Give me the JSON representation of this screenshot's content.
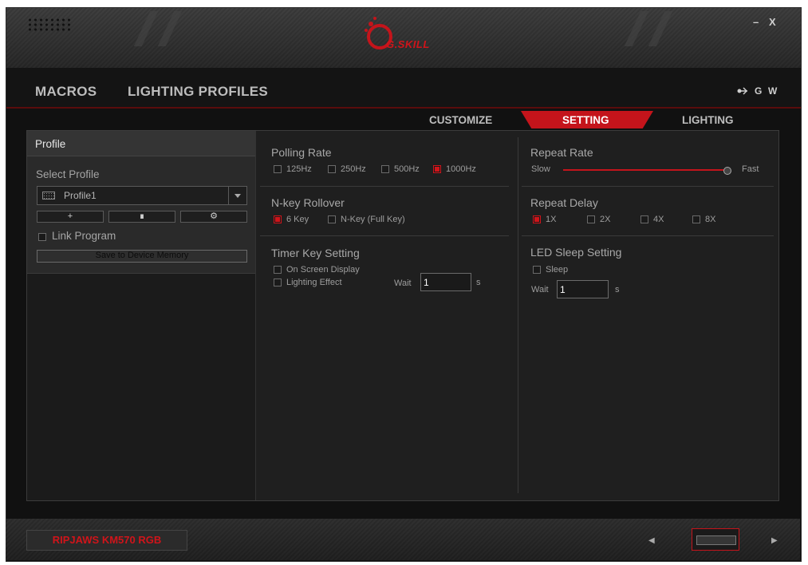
{
  "window": {
    "brand": "G.SKILL",
    "minimize": "–",
    "close": "X"
  },
  "nav": {
    "macros": "MACROS",
    "lighting_profiles": "LIGHTING PROFILES",
    "right_icons": [
      "link-icon",
      "G",
      "W"
    ],
    "g": "G",
    "w": "W"
  },
  "tabs": [
    {
      "label": "CUSTOMIZE",
      "active": false
    },
    {
      "label": "SETTING",
      "active": true
    },
    {
      "label": "LIGHTING",
      "active": false
    }
  ],
  "profile_panel": {
    "header": "Profile",
    "select_label": "Select Profile",
    "selected_profile": "Profile1",
    "add": "+",
    "delete": "∎",
    "settings": "⚙",
    "link_program": "Link Program",
    "save": "Save to Device Memory"
  },
  "polling": {
    "title": "Polling Rate",
    "options": [
      {
        "label": "125Hz",
        "checked": false
      },
      {
        "label": "250Hz",
        "checked": false
      },
      {
        "label": "500Hz",
        "checked": false
      },
      {
        "label": "1000Hz",
        "checked": true
      }
    ]
  },
  "rollover": {
    "title": "N-key Rollover",
    "options": [
      {
        "label": "6 Key",
        "checked": true
      },
      {
        "label": "N-Key (Full Key)",
        "checked": false
      }
    ]
  },
  "timer": {
    "title": "Timer Key Setting",
    "on_screen": "On Screen Display",
    "lighting_effect": "Lighting Effect",
    "wait_label": "Wait",
    "wait_value": "1",
    "unit": "s"
  },
  "repeat_rate": {
    "title": "Repeat Rate",
    "slow": "Slow",
    "fast": "Fast",
    "value": 1.0
  },
  "repeat_delay": {
    "title": "Repeat Delay",
    "options": [
      {
        "label": "1X",
        "checked": true
      },
      {
        "label": "2X",
        "checked": false
      },
      {
        "label": "4X",
        "checked": false
      },
      {
        "label": "8X",
        "checked": false
      }
    ]
  },
  "led_sleep": {
    "title": "LED Sleep Setting",
    "sleep": "Sleep",
    "wait_label": "Wait",
    "wait_value": "1",
    "unit": "s"
  },
  "footer": {
    "model": "RIPJAWS KM570 RGB",
    "prev": "◀",
    "next": "▶"
  },
  "colors": {
    "accent": "#c4141b",
    "background": "#1f1f1f"
  }
}
